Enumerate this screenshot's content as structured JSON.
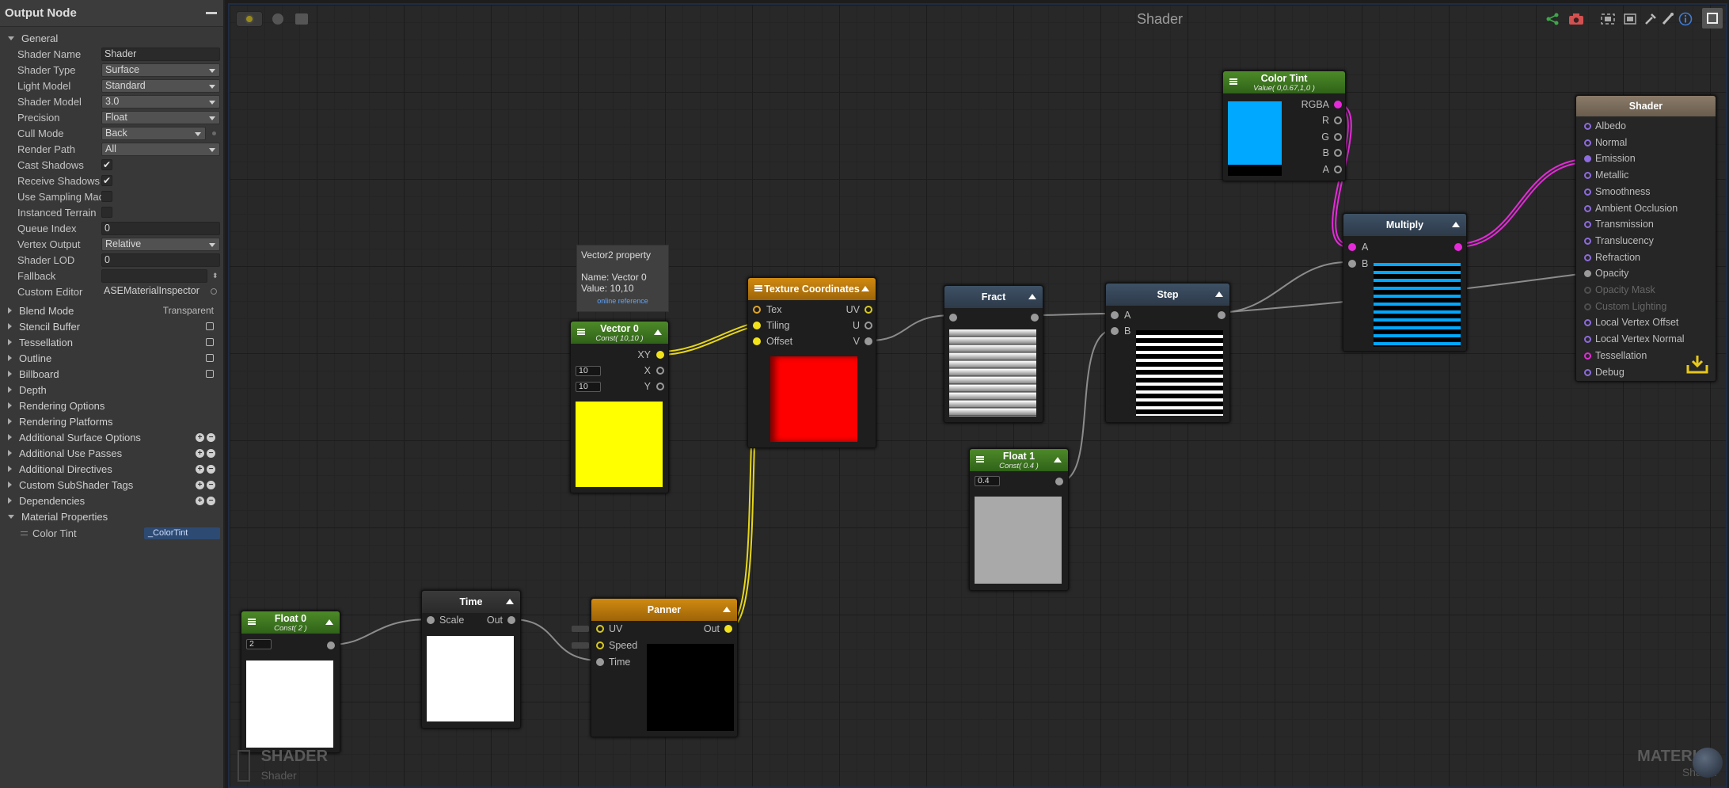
{
  "panel": {
    "title": "Output Node",
    "general_label": "General",
    "props": {
      "shader_name": {
        "label": "Shader Name",
        "value": "Shader"
      },
      "shader_type": {
        "label": "Shader Type",
        "value": "Surface"
      },
      "light_model": {
        "label": "Light Model",
        "value": "Standard"
      },
      "shader_model": {
        "label": "Shader Model",
        "value": "3.0"
      },
      "precision": {
        "label": "Precision",
        "value": "Float"
      },
      "cull_mode": {
        "label": "Cull Mode",
        "value": "Back"
      },
      "render_path": {
        "label": "Render Path",
        "value": "All"
      },
      "cast_shadows": {
        "label": "Cast Shadows",
        "value": "✔"
      },
      "receive_shadows": {
        "label": "Receive Shadows",
        "value": "✔"
      },
      "use_sampling": {
        "label": "Use Sampling Mac"
      },
      "instanced_terrain": {
        "label": "Instanced Terrain"
      },
      "queue_index": {
        "label": "Queue Index",
        "value": "0"
      },
      "vertex_output": {
        "label": "Vertex Output",
        "value": "Relative"
      },
      "shader_lod": {
        "label": "Shader LOD",
        "value": "0"
      },
      "fallback": {
        "label": "Fallback",
        "value": ""
      },
      "custom_editor": {
        "label": "Custom Editor",
        "value": "ASEMaterialInspector"
      }
    },
    "sections": {
      "blend_mode": {
        "label": "Blend Mode",
        "value": "Transparent"
      },
      "stencil": "Stencil Buffer",
      "tessellation": "Tessellation",
      "outline": "Outline",
      "billboard": "Billboard",
      "depth": "Depth",
      "rendering_options": "Rendering Options",
      "rendering_platforms": "Rendering Platforms",
      "add_surface": "Additional Surface Options",
      "add_use_passes": "Additional Use Passes",
      "add_directives": "Additional Directives",
      "custom_subshader": "Custom SubShader Tags",
      "dependencies": "Dependencies",
      "material_properties": "Material Properties"
    },
    "material_property": {
      "label": "Color Tint",
      "value": "_ColorTint"
    }
  },
  "canvas": {
    "title": "Shader",
    "watermark_left": {
      "title": "SHADER",
      "sub": "Shader"
    },
    "watermark_right": {
      "title": "MATERIAL",
      "sub": "Shader"
    }
  },
  "tooltip": {
    "title": "Vector2 property",
    "name": "Name: Vector 0",
    "value": "Value: 10,10",
    "link": "online reference"
  },
  "nodes": {
    "vector0": {
      "title": "Vector 0",
      "sub": "Const( 10,10 )",
      "out": "XY",
      "x_label": "X",
      "y_label": "Y",
      "x_val": "10",
      "y_val": "10",
      "color": "#ffff00"
    },
    "texcoord": {
      "title": "Texture Coordinates",
      "in": [
        "Tex",
        "Tiling",
        "Offset"
      ],
      "out": [
        "UV",
        "U",
        "V"
      ],
      "color": "#ff0000"
    },
    "fract": {
      "title": "Fract"
    },
    "step": {
      "title": "Step",
      "a": "A",
      "b": "B"
    },
    "float1": {
      "title": "Float 1",
      "sub": "Const( 0.4 )",
      "value": "0.4",
      "color": "#a9a9a9"
    },
    "colortint": {
      "title": "Color Tint",
      "sub": "Value( 0,0.67,1,0 )",
      "out": [
        "RGBA",
        "R",
        "G",
        "B",
        "A"
      ],
      "color": "#00a8ff"
    },
    "multiply": {
      "title": "Multiply",
      "a": "A",
      "b": "B"
    },
    "float0": {
      "title": "Float 0",
      "sub": "Const( 2 )",
      "value": "2",
      "color": "#ffffff"
    },
    "time": {
      "title": "Time",
      "in": "Scale",
      "out": "Out",
      "color": "#ffffff"
    },
    "panner": {
      "title": "Panner",
      "in": [
        "UV",
        "Speed",
        "Time"
      ],
      "out": "Out",
      "color": "#000000"
    },
    "shader": {
      "title": "Shader",
      "inputs": [
        "Albedo",
        "Normal",
        "Emission",
        "Metallic",
        "Smoothness",
        "Ambient Occlusion",
        "Transmission",
        "Translucency",
        "Refraction",
        "Opacity",
        "Opacity Mask",
        "Custom Lighting",
        "Local Vertex Offset",
        "Local Vertex Normal",
        "Tessellation",
        "Debug"
      ]
    }
  }
}
